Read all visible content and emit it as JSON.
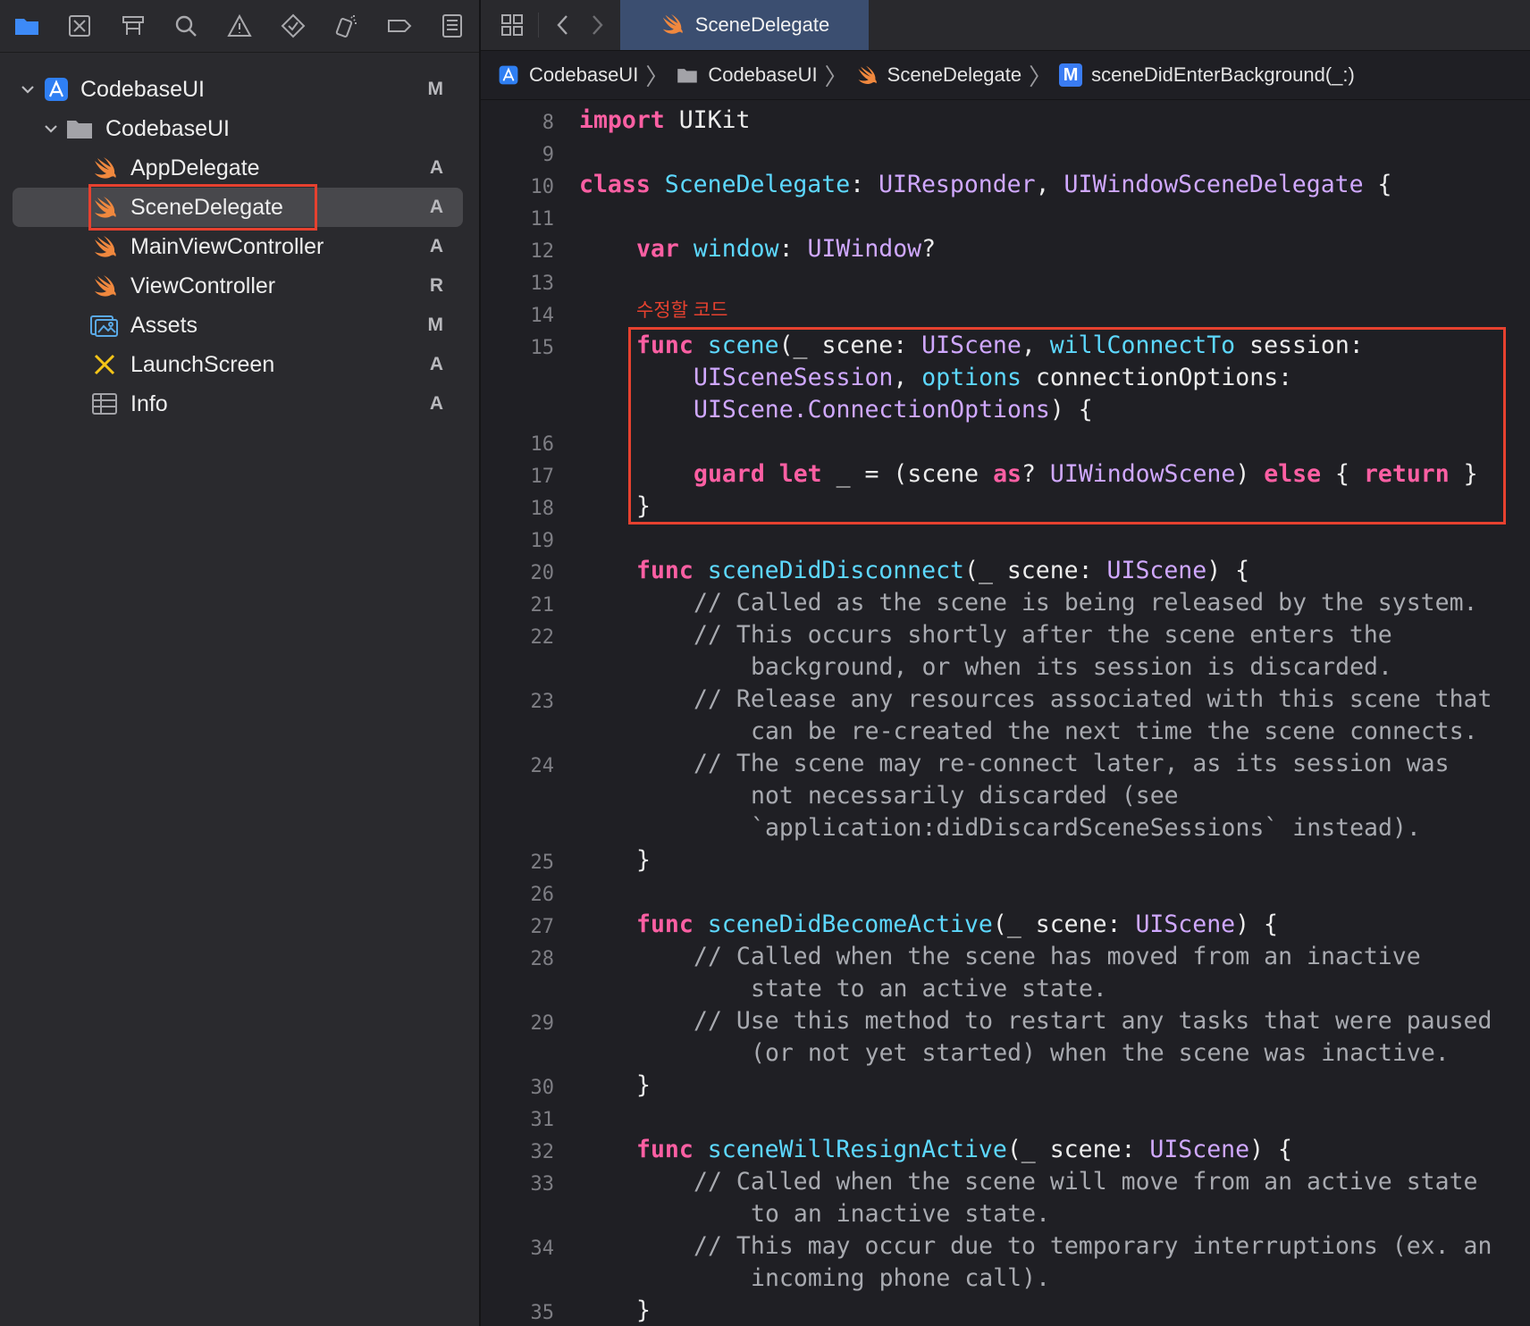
{
  "sidebar": {
    "toolbar_icons": [
      "folder-icon",
      "source-control-icon",
      "symbol-navigator-icon",
      "search-icon",
      "warning-icon",
      "test-icon",
      "debug-icon",
      "breakpoint-icon",
      "report-icon"
    ],
    "items": [
      {
        "label": "CodebaseUI",
        "status": "M",
        "icon": "xcode-project-icon",
        "level": 0,
        "expanded": true
      },
      {
        "label": "CodebaseUI",
        "status": "",
        "icon": "folder-icon",
        "level": 1,
        "expanded": true
      },
      {
        "label": "AppDelegate",
        "status": "A",
        "icon": "swift-icon",
        "level": 2
      },
      {
        "label": "SceneDelegate",
        "status": "A",
        "icon": "swift-icon",
        "level": 2,
        "selected": true
      },
      {
        "label": "MainViewController",
        "status": "A",
        "icon": "swift-icon",
        "level": 2
      },
      {
        "label": "ViewController",
        "status": "R",
        "icon": "swift-icon",
        "level": 2
      },
      {
        "label": "Assets",
        "status": "M",
        "icon": "assets-icon",
        "level": 2
      },
      {
        "label": "LaunchScreen",
        "status": "A",
        "icon": "storyboard-icon",
        "level": 2
      },
      {
        "label": "Info",
        "status": "A",
        "icon": "plist-icon",
        "level": 2
      }
    ]
  },
  "editor": {
    "tab": {
      "label": "SceneDelegate",
      "icon": "swift-icon"
    },
    "breadcrumbs": [
      {
        "label": "CodebaseUI",
        "icon": "xcode-project-icon"
      },
      {
        "label": "CodebaseUI",
        "icon": "folder-icon"
      },
      {
        "label": "SceneDelegate",
        "icon": "swift-icon"
      },
      {
        "label": "sceneDidEnterBackground(_:)",
        "icon": "method-icon",
        "badge": "M"
      }
    ],
    "annotation": "수정할 코드",
    "line_numbers": [
      "8",
      "9",
      "10",
      "11",
      "12",
      "13",
      "14",
      "15",
      "16",
      "17",
      "18",
      "19",
      "20",
      "21",
      "22",
      "23",
      "24",
      "25",
      "26",
      "27",
      "28",
      "29",
      "30",
      "31",
      "32",
      "33",
      "34",
      "35"
    ],
    "code": {
      "l8_kw": "import",
      "l8_rest": " UIKit",
      "l10_kw": "class",
      "l10_name": "SceneDelegate",
      "l10_p1": ": ",
      "l10_t1": "UIResponder",
      "l10_p2": ", ",
      "l10_t2": "UIWindowSceneDelegate",
      "l10_p3": " {",
      "l12_kw": "var",
      "l12_name": "window",
      "l12_p1": ": ",
      "l12_t1": "UIWindow",
      "l12_p2": "?",
      "l15_kw": "func",
      "l15_name": "scene",
      "l15_p1": "(_ scene: ",
      "l15_t1": "UIScene",
      "l15_p2": ", ",
      "l15_arg": "willConnectTo",
      "l15_p3": " session:",
      "l15b_t1": "UISceneSession",
      "l15b_p1": ", ",
      "l15b_arg": "options",
      "l15b_p2": " connectionOptions:",
      "l15c_t1": "UIScene.ConnectionOptions",
      "l15c_p1": ") {",
      "l17_kw1": "guard",
      "l17_kw2": "let",
      "l17_p1": " _ = (scene ",
      "l17_kw3": "as",
      "l17_p2": "? ",
      "l17_t1": "UIWindowScene",
      "l17_p3": ") ",
      "l17_kw4": "else",
      "l17_p4": " { ",
      "l17_kw5": "return",
      "l17_p5": " }",
      "close_brace": "}",
      "l20_kw": "func",
      "l20_name": "sceneDidDisconnect",
      "l20_p1": "(_ scene: ",
      "l20_t1": "UIScene",
      "l20_p2": ") {",
      "l21": "// Called as the scene is being released by the system.",
      "l22a": "// This occurs shortly after the scene enters the",
      "l22b": "background, or when its session is discarded.",
      "l23a": "// Release any resources associated with this scene that",
      "l23b": "can be re-created the next time the scene connects.",
      "l24a": "// The scene may re-connect later, as its session was",
      "l24b": "not necessarily discarded (see",
      "l24c": "`application:didDiscardSceneSessions` instead).",
      "l27_kw": "func",
      "l27_name": "sceneDidBecomeActive",
      "l27_p1": "(_ scene: ",
      "l27_t1": "UIScene",
      "l27_p2": ") {",
      "l28a": "// Called when the scene has moved from an inactive",
      "l28b": "state to an active state.",
      "l29a": "// Use this method to restart any tasks that were paused",
      "l29b": "(or not yet started) when the scene was inactive.",
      "l32_kw": "func",
      "l32_name": "sceneWillResignActive",
      "l32_p1": "(_ scene: ",
      "l32_t1": "UIScene",
      "l32_p2": ") {",
      "l33a": "// Called when the scene will move from an active state",
      "l33b": "to an inactive state.",
      "l34a": "// This may occur due to temporary interruptions (ex. an",
      "l34b": "incoming phone call)."
    }
  },
  "colors": {
    "highlight": "#e6412f",
    "keyword": "#fc5fa3",
    "type": "#d0a8ff",
    "declaration": "#5dd8ff",
    "comment": "#a8aab0",
    "swift": "#f0883e"
  }
}
